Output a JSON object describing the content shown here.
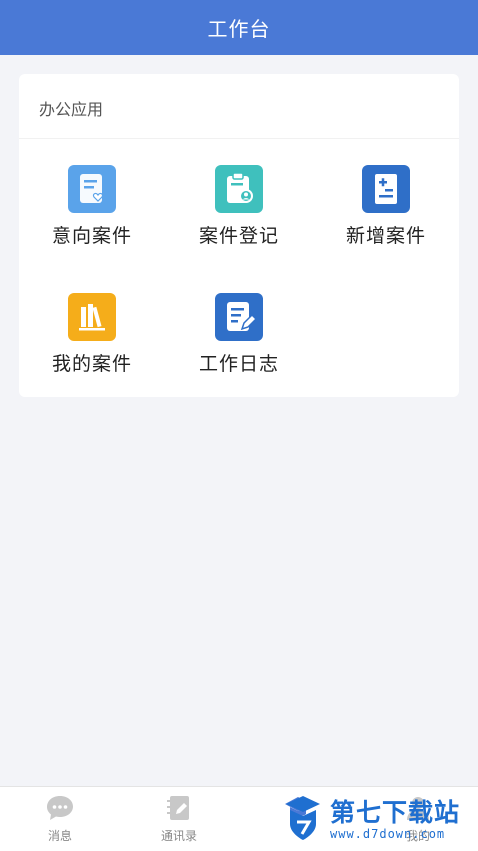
{
  "header": {
    "title": "工作台"
  },
  "section": {
    "title": "办公应用"
  },
  "apps": [
    {
      "label": "意向案件",
      "icon": "document-heart-icon",
      "color": "#5aa3ea"
    },
    {
      "label": "案件登记",
      "icon": "clipboard-user-icon",
      "color": "#3fc0bd"
    },
    {
      "label": "新增案件",
      "icon": "document-plus-icon",
      "color": "#2f6fc8"
    },
    {
      "label": "我的案件",
      "icon": "books-icon",
      "color": "#f5ad1a"
    },
    {
      "label": "工作日志",
      "icon": "document-pen-icon",
      "color": "#2f6fc8"
    }
  ],
  "tabbar": [
    {
      "label": "消息",
      "icon": "chat-bubble-icon"
    },
    {
      "label": "通讯录",
      "icon": "notebook-pen-icon"
    },
    {
      "label": "",
      "icon": "graduation-cap-icon"
    },
    {
      "label": "我的",
      "icon": "user-icon"
    }
  ],
  "watermark": {
    "main": "第七下载站",
    "sub": "www.d7down.com"
  }
}
